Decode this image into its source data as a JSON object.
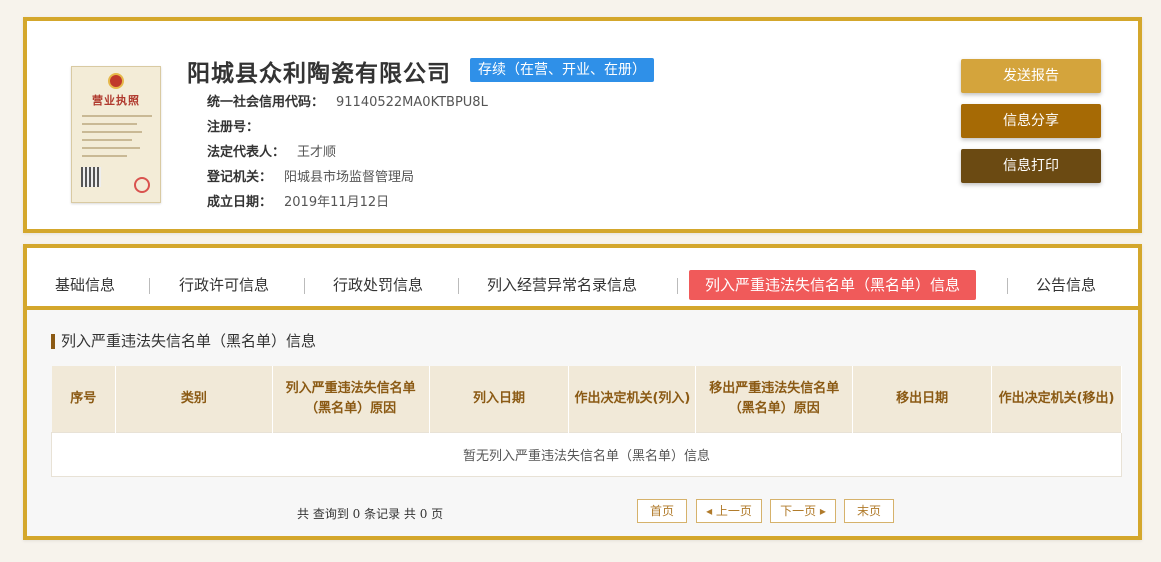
{
  "company": {
    "name": "阳城县众利陶瓷有限公司",
    "status": "存续（在营、开业、在册）",
    "fields": [
      {
        "key": "统一社会信用代码：",
        "value": "91140522MA0KTBPU8L"
      },
      {
        "key": "注册号：",
        "value": ""
      },
      {
        "key": "法定代表人：",
        "value": "王才顺"
      },
      {
        "key": "登记机关：",
        "value": "阳城县市场监督管理局"
      },
      {
        "key": "成立日期：",
        "value": "2019年11月12日"
      }
    ],
    "license_title": "营业执照"
  },
  "actions": {
    "send_report": "发送报告",
    "share": "信息分享",
    "print": "信息打印"
  },
  "tabs": [
    {
      "label": "基础信息"
    },
    {
      "label": "行政许可信息"
    },
    {
      "label": "行政处罚信息"
    },
    {
      "label": "列入经营异常名录信息"
    },
    {
      "label": "列入严重违法失信名单（黑名单）信息"
    },
    {
      "label": "公告信息"
    }
  ],
  "section": {
    "title": "列入严重违法失信名单（黑名单）信息",
    "columns": [
      "序号",
      "类别",
      "列入严重违法失信名单（黑名单）原因",
      "列入日期",
      "作出决定机关(列入)",
      "移出严重违法失信名单（黑名单）原因",
      "移出日期",
      "作出决定机关(移出)"
    ],
    "empty_text": "暂无列入严重违法失信名单（黑名单）信息"
  },
  "pagination": {
    "summary": "共 查询到 0 条记录 共 0 页",
    "first": "首页",
    "prev": "◂ 上一页",
    "next": "下一页 ▸",
    "last": "末页"
  },
  "colors": {
    "frame": "#d4a72c",
    "active_tab": "#f05a5a",
    "status_badge": "#2f90e8",
    "btn_report": "#d4a43c",
    "btn_share": "#a66a05",
    "btn_print": "#6b4a12"
  }
}
